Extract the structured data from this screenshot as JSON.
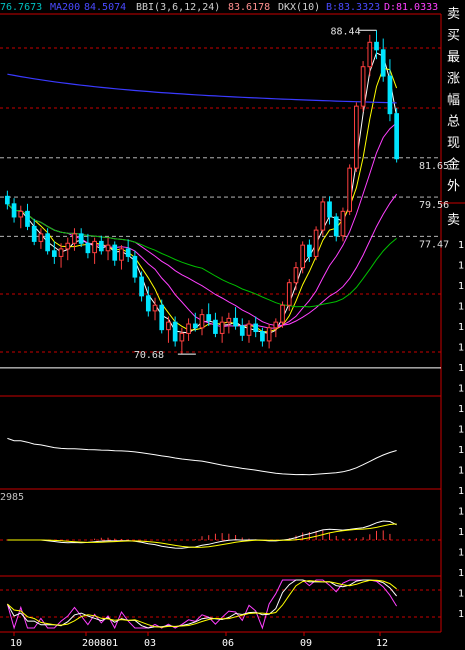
{
  "header": {
    "ma_left": "76.7673",
    "ma200_label": "MA200",
    "ma200_value": "84.5074",
    "bbi_label": "BBI(3,6,12,24)",
    "bbi_value": "83.6178",
    "dkx_label": "DKX(10)",
    "dkx_b_label": "B:",
    "dkx_b_value": "83.3323",
    "dkx_d_label": "D:",
    "dkx_d_value": "81.0333"
  },
  "side_glyphs": [
    "卖",
    "买",
    "最",
    "涨",
    "幅",
    "总",
    "现",
    "金",
    "外",
    "卖"
  ],
  "right_axis_marks": [
    "1",
    "1",
    "1",
    "1",
    "1",
    "1",
    "1",
    "1",
    "1",
    "1",
    "1",
    "1",
    "1",
    "1",
    "1",
    "1",
    "1",
    "1",
    "1"
  ],
  "sub_label": "2985",
  "colors": {
    "background": "#000000",
    "up_candle": "#ff4040",
    "down_candle": "#00e5ff",
    "grid": "#c80000",
    "ma200": "#3a3aff",
    "ma_green": "#00c000",
    "ma_yellow": "#ffff00",
    "ma_magenta": "#ff40ff",
    "ma_white": "#ffffff"
  },
  "chart_data": [
    {
      "type": "candlestick",
      "x_tick_labels": [
        "10",
        "200801",
        "03",
        "06",
        "09",
        "12"
      ],
      "annotations": [
        {
          "text": "88.44",
          "kind": "high"
        },
        {
          "text": "70.68",
          "kind": "low"
        }
      ],
      "levels": [
        "81.65",
        "79.56",
        "77.47"
      ],
      "level_values": [
        81.65,
        79.56,
        77.47
      ],
      "ylim": [
        69.5,
        89.2
      ],
      "candles": [
        [
          79.6,
          79.9,
          78.9,
          79.2
        ],
        [
          79.2,
          79.5,
          78.2,
          78.5
        ],
        [
          78.5,
          79.1,
          77.9,
          78.8
        ],
        [
          78.8,
          79.2,
          77.8,
          78.0
        ],
        [
          78.0,
          78.4,
          77.0,
          77.2
        ],
        [
          77.2,
          77.9,
          76.8,
          77.6
        ],
        [
          77.6,
          77.9,
          76.5,
          76.7
        ],
        [
          76.7,
          77.2,
          76.0,
          76.4
        ],
        [
          76.4,
          77.1,
          75.8,
          76.8
        ],
        [
          76.8,
          77.4,
          76.2,
          77.1
        ],
        [
          77.1,
          77.9,
          76.7,
          77.6
        ],
        [
          77.6,
          77.9,
          76.9,
          77.1
        ],
        [
          77.1,
          77.6,
          76.3,
          76.6
        ],
        [
          76.6,
          77.4,
          76.0,
          77.2
        ],
        [
          77.2,
          77.5,
          76.5,
          76.7
        ],
        [
          76.7,
          77.4,
          76.2,
          77.0
        ],
        [
          77.0,
          77.2,
          75.9,
          76.2
        ],
        [
          76.2,
          77.0,
          75.7,
          76.8
        ],
        [
          76.8,
          77.3,
          76.1,
          76.4
        ],
        [
          76.4,
          76.7,
          75.0,
          75.3
        ],
        [
          75.3,
          75.6,
          74.0,
          74.3
        ],
        [
          74.3,
          74.8,
          73.2,
          73.5
        ],
        [
          73.5,
          74.2,
          73.0,
          73.8
        ],
        [
          73.8,
          74.1,
          72.3,
          72.5
        ],
        [
          72.5,
          73.2,
          71.8,
          72.9
        ],
        [
          72.9,
          73.2,
          71.6,
          71.9
        ],
        [
          71.9,
          72.6,
          71.2,
          72.3
        ],
        [
          72.3,
          73.1,
          71.9,
          72.8
        ],
        [
          72.8,
          73.4,
          72.4,
          72.6
        ],
        [
          72.6,
          73.6,
          72.2,
          73.3
        ],
        [
          73.3,
          73.9,
          72.7,
          73.0
        ],
        [
          73.0,
          73.4,
          72.1,
          72.3
        ],
        [
          72.3,
          73.2,
          71.8,
          72.9
        ],
        [
          72.9,
          73.4,
          72.3,
          73.1
        ],
        [
          73.1,
          73.7,
          72.5,
          72.7
        ],
        [
          72.7,
          73.1,
          71.9,
          72.2
        ],
        [
          72.2,
          73.0,
          71.8,
          72.8
        ],
        [
          72.8,
          73.2,
          72.1,
          72.4
        ],
        [
          72.4,
          72.6,
          71.6,
          71.9
        ],
        [
          71.9,
          72.8,
          71.5,
          72.6
        ],
        [
          72.6,
          73.1,
          72.1,
          72.9
        ],
        [
          72.9,
          74.0,
          72.6,
          73.8
        ],
        [
          73.8,
          75.2,
          73.5,
          75.0
        ],
        [
          75.0,
          76.1,
          74.6,
          75.8
        ],
        [
          75.8,
          77.2,
          75.5,
          77.0
        ],
        [
          77.0,
          77.3,
          76.1,
          76.4
        ],
        [
          76.4,
          78.0,
          76.2,
          77.8
        ],
        [
          77.8,
          79.5,
          77.5,
          79.3
        ],
        [
          79.3,
          79.6,
          78.1,
          78.5
        ],
        [
          78.5,
          78.7,
          77.2,
          77.5
        ],
        [
          77.5,
          79.0,
          77.2,
          78.8
        ],
        [
          78.8,
          81.3,
          78.6,
          81.1
        ],
        [
          81.1,
          84.6,
          80.9,
          84.4
        ],
        [
          84.4,
          86.8,
          84.1,
          86.5
        ],
        [
          86.5,
          88.2,
          86.0,
          87.8
        ],
        [
          87.8,
          88.44,
          86.9,
          87.4
        ],
        [
          87.4,
          88.0,
          85.7,
          86.0
        ],
        [
          86.0,
          86.9,
          83.6,
          84.0
        ],
        [
          84.0,
          84.3,
          81.4,
          81.6
        ]
      ]
    }
  ]
}
